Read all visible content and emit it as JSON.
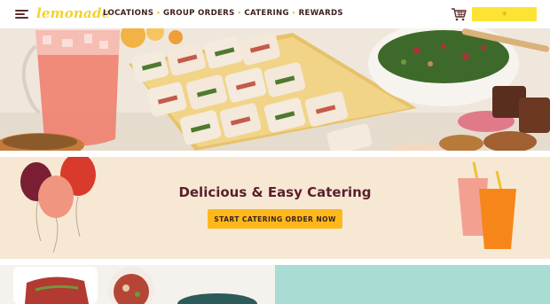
{
  "header": {
    "logo_text": "lemonade",
    "nav": [
      {
        "label": "LOCATIONS"
      },
      {
        "label": "GROUP ORDERS"
      },
      {
        "label": "CATERING"
      },
      {
        "label": "REWARDS"
      }
    ],
    "icons": [
      "menu-icon",
      "cart-icon"
    ]
  },
  "banner": {
    "title": "Delicious & Easy Catering",
    "button_label": "START CATERING ORDER NOW"
  },
  "colors": {
    "brand_yellow": "#fde333",
    "button_orange": "#fdb81c",
    "title_maroon": "#5a1f2d",
    "banner_bg": "#f7e8d4",
    "teal_panel": "#a9dcd3"
  }
}
